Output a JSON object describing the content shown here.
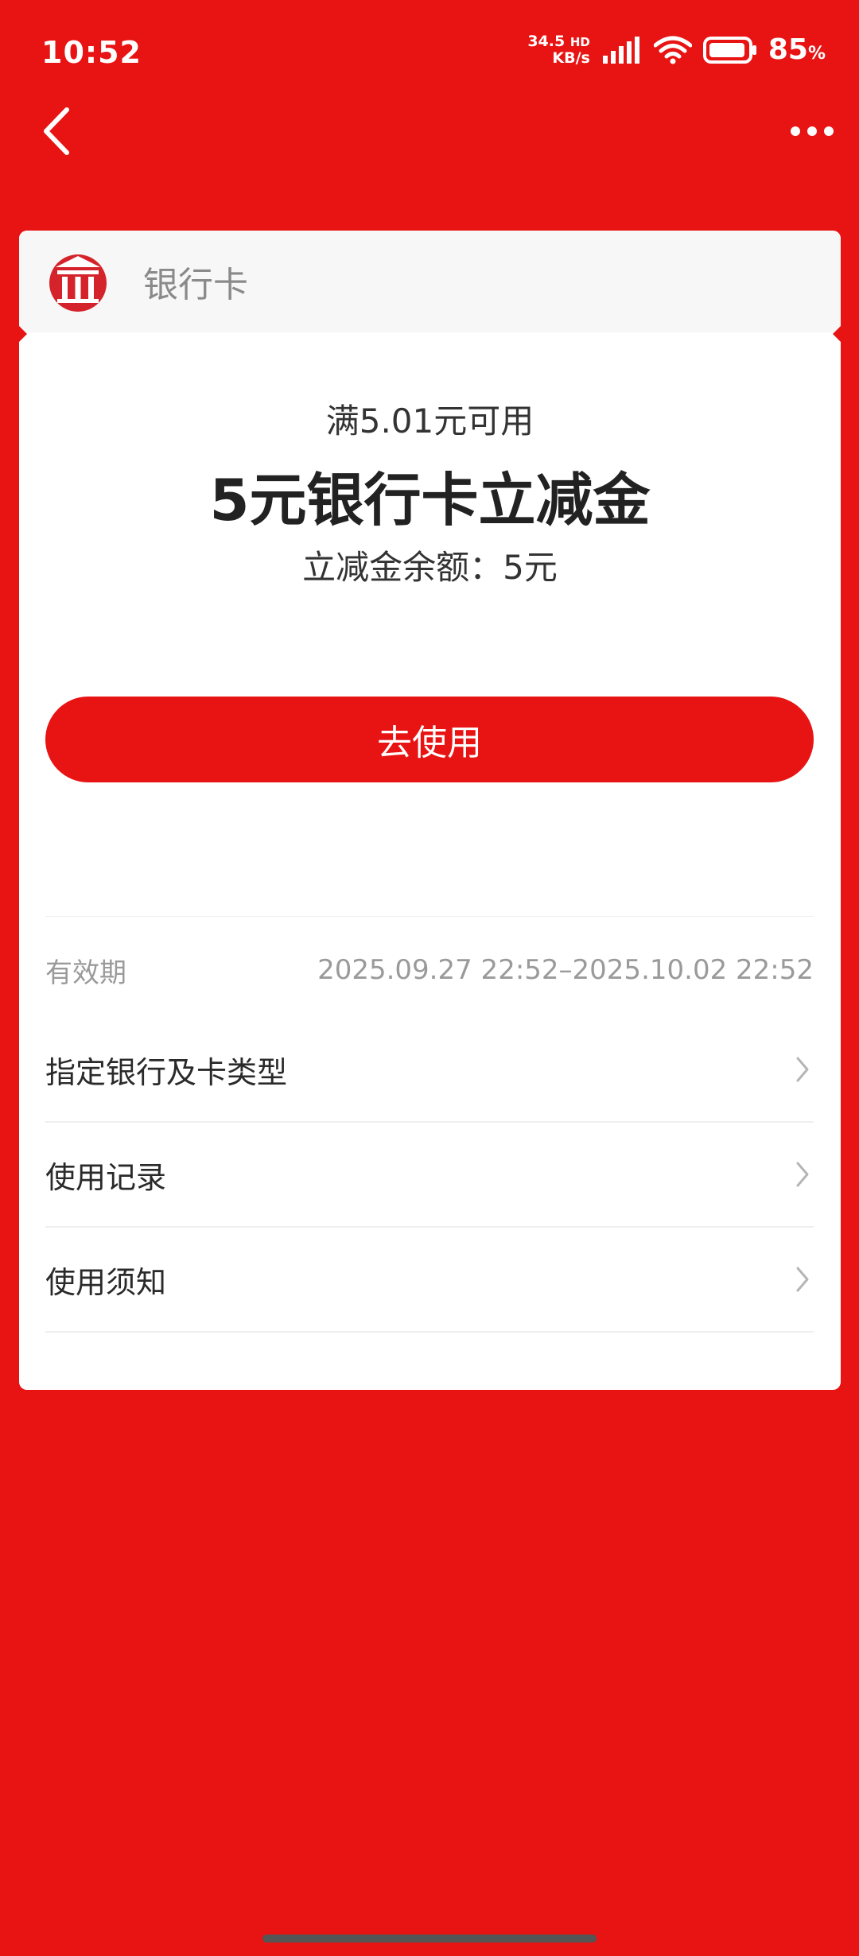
{
  "status_bar": {
    "time": "10:52",
    "net_speed_value": "34.5",
    "net_speed_unit": "KB/s",
    "net_type": "HD",
    "battery_percent": "85",
    "percent_sign": "%"
  },
  "nav": {
    "back_icon": "chevron-left-icon",
    "more_icon": "more-horizontal-icon"
  },
  "card": {
    "header_title": "银行卡",
    "bank_icon": "bank-icon",
    "condition": "满5.01元可用",
    "title": "5元银行卡立减金",
    "balance": "立减金余额：5元",
    "use_button": "去使用",
    "validity_label": "有效期",
    "validity_value": "2025.09.27 22:52–2025.10.02 22:52",
    "items": [
      {
        "label": "指定银行及卡类型"
      },
      {
        "label": "使用记录"
      },
      {
        "label": "使用须知"
      }
    ]
  },
  "colors": {
    "brand_red": "#E81313",
    "header_bg": "#F7F7F7"
  }
}
